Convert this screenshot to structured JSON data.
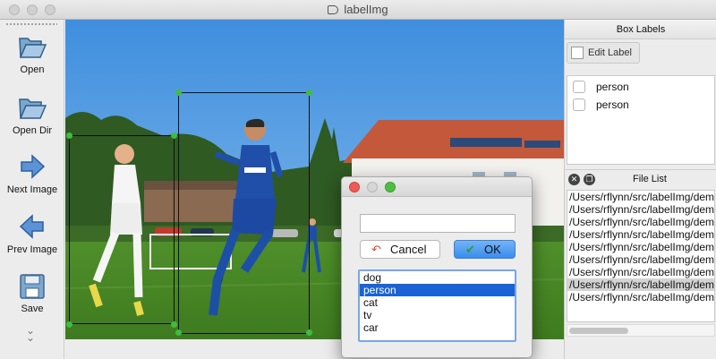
{
  "window": {
    "title": "labelImg"
  },
  "toolbar": {
    "tools": [
      {
        "name": "open",
        "label": "Open",
        "icon": "folder-open-icon"
      },
      {
        "name": "open-dir",
        "label": "Open Dir",
        "icon": "folder-open-icon"
      },
      {
        "name": "next-image",
        "label": "Next Image",
        "icon": "arrow-right-icon"
      },
      {
        "name": "prev-image",
        "label": "Prev Image",
        "icon": "arrow-left-icon"
      },
      {
        "name": "save",
        "label": "Save",
        "icon": "floppy-disk-icon"
      }
    ],
    "more_icon": "chevron-double-down-icon"
  },
  "box_labels": {
    "title": "Box Labels",
    "edit_button": "Edit Label",
    "items": [
      {
        "label": "person",
        "checked": false
      },
      {
        "label": "person",
        "checked": false
      }
    ]
  },
  "file_list": {
    "title": "File List",
    "files": [
      "/Users/rflynn/src/labelImg/demo/",
      "/Users/rflynn/src/labelImg/demo/",
      "/Users/rflynn/src/labelImg/demo/",
      "/Users/rflynn/src/labelImg/demo/",
      "/Users/rflynn/src/labelImg/demo/",
      "/Users/rflynn/src/labelImg/demo/",
      "/Users/rflynn/src/labelImg/demo/",
      "/Users/rflynn/src/labelImg/demo/",
      "/Users/rflynn/src/labelImg/demo/"
    ],
    "selected_index": 7
  },
  "dialog": {
    "input_value": "",
    "cancel_label": "Cancel",
    "ok_label": "OK",
    "options": [
      "dog",
      "person",
      "cat",
      "tv",
      "car"
    ],
    "selected_option": "person"
  },
  "colors": {
    "accent": "#1b62d4",
    "ok_button": "#3a8cee",
    "box_handle": "#3fbd3f",
    "close_dot": "#ee5b55",
    "minimize_dot": "#d6d6d6",
    "zoom_dot": "#4fbf44"
  }
}
